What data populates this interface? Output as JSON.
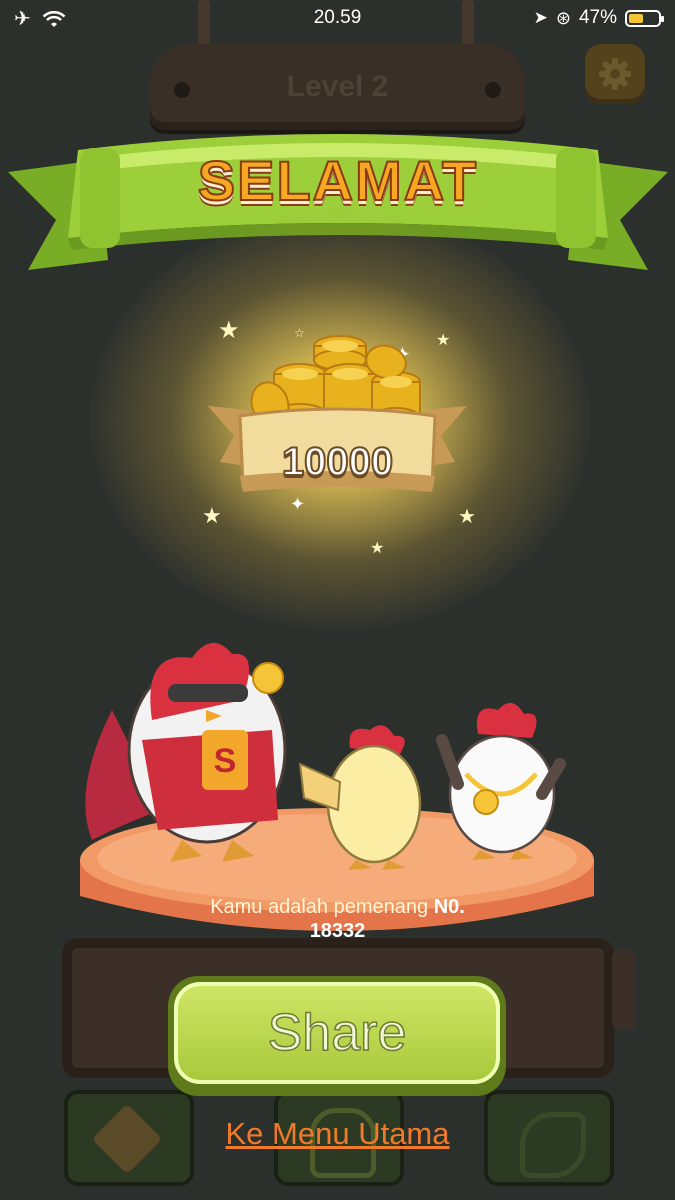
{
  "status_bar": {
    "time": "20.59",
    "battery_percent": "47%"
  },
  "level": {
    "label": "Level  2"
  },
  "banner": {
    "title": "SELAMAT"
  },
  "reward": {
    "coins": "10000"
  },
  "winner": {
    "prefix": "Kamu adalah pemenang ",
    "rank_label": "N0.",
    "rank_number": "18332"
  },
  "actions": {
    "share_label": "Share",
    "menu_link": "Ke Menu Utama"
  },
  "icons": [
    "airplane-icon",
    "wifi-icon",
    "location-arrow-icon",
    "lock-rotation-icon",
    "battery-icon",
    "settings-gear-icon",
    "coin-icon",
    "star-icon",
    "rooster-character",
    "chick-character",
    "hen-character"
  ],
  "colors": {
    "background": "#2c302d",
    "banner_green": "#9ccf3a",
    "title_orange": "#f6a823",
    "button_green": "#bcd64f",
    "stage_orange": "#ef8f5e",
    "link_orange": "#f07a2a"
  }
}
